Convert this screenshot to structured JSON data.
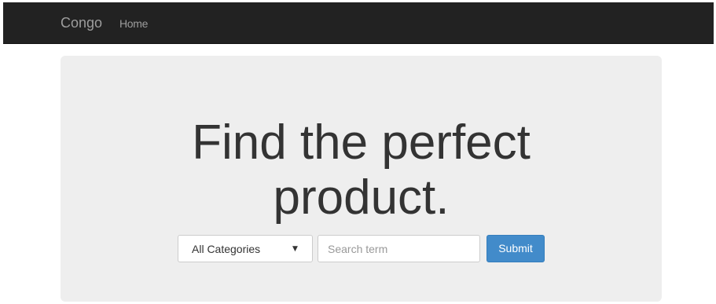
{
  "navbar": {
    "brand": "Congo",
    "items": [
      {
        "label": "Home"
      }
    ]
  },
  "hero": {
    "headline_line1": "Find the perfect",
    "headline_line2": "product."
  },
  "search": {
    "category_selected": "All Categories",
    "category_caret": "▼",
    "term_placeholder": "Search term",
    "term_value": "",
    "submit_label": "Submit"
  },
  "colors": {
    "navbar_bg": "#222222",
    "navbar_text": "#9d9d9d",
    "jumbotron_bg": "#eeeeee",
    "headline": "#333333",
    "primary_button": "#428bca"
  }
}
